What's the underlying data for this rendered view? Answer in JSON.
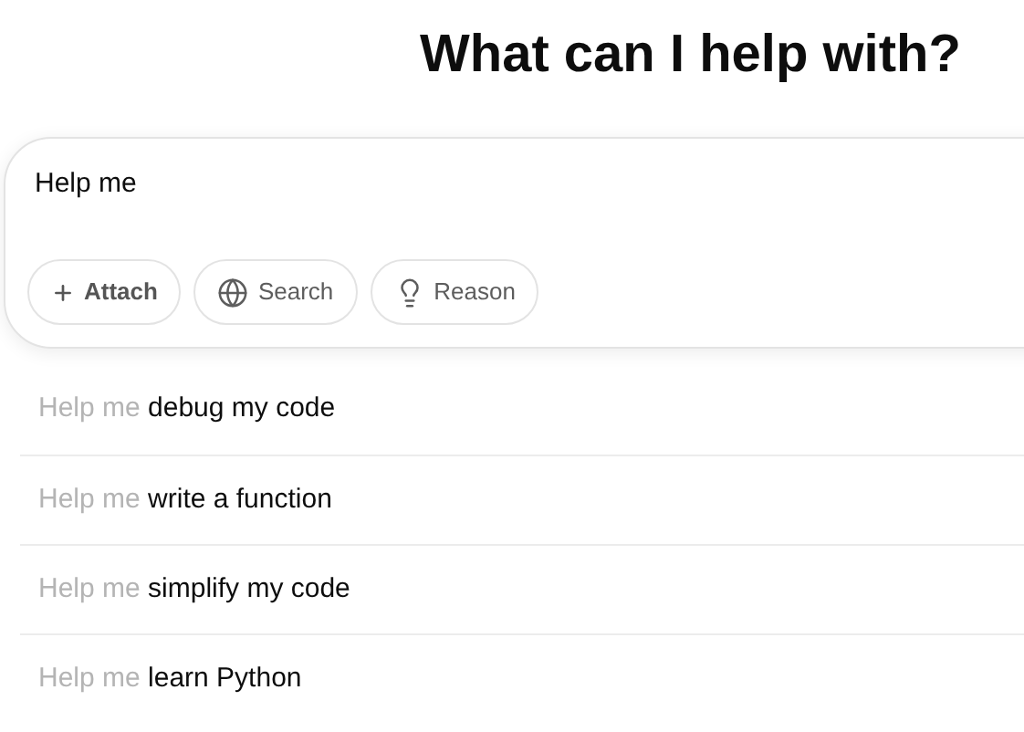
{
  "heading": "What can I help with?",
  "composer": {
    "value": "Help me",
    "buttons": [
      {
        "kind": "attach",
        "label": "Attach"
      },
      {
        "kind": "search",
        "label": "Search"
      },
      {
        "kind": "reason",
        "label": "Reason"
      }
    ]
  },
  "suggestions": [
    {
      "prefix": "Help me",
      "text": "debug my code"
    },
    {
      "prefix": "Help me",
      "text": "write a function"
    },
    {
      "prefix": "Help me",
      "text": "simplify my code"
    },
    {
      "prefix": "Help me",
      "text": "learn Python"
    }
  ]
}
